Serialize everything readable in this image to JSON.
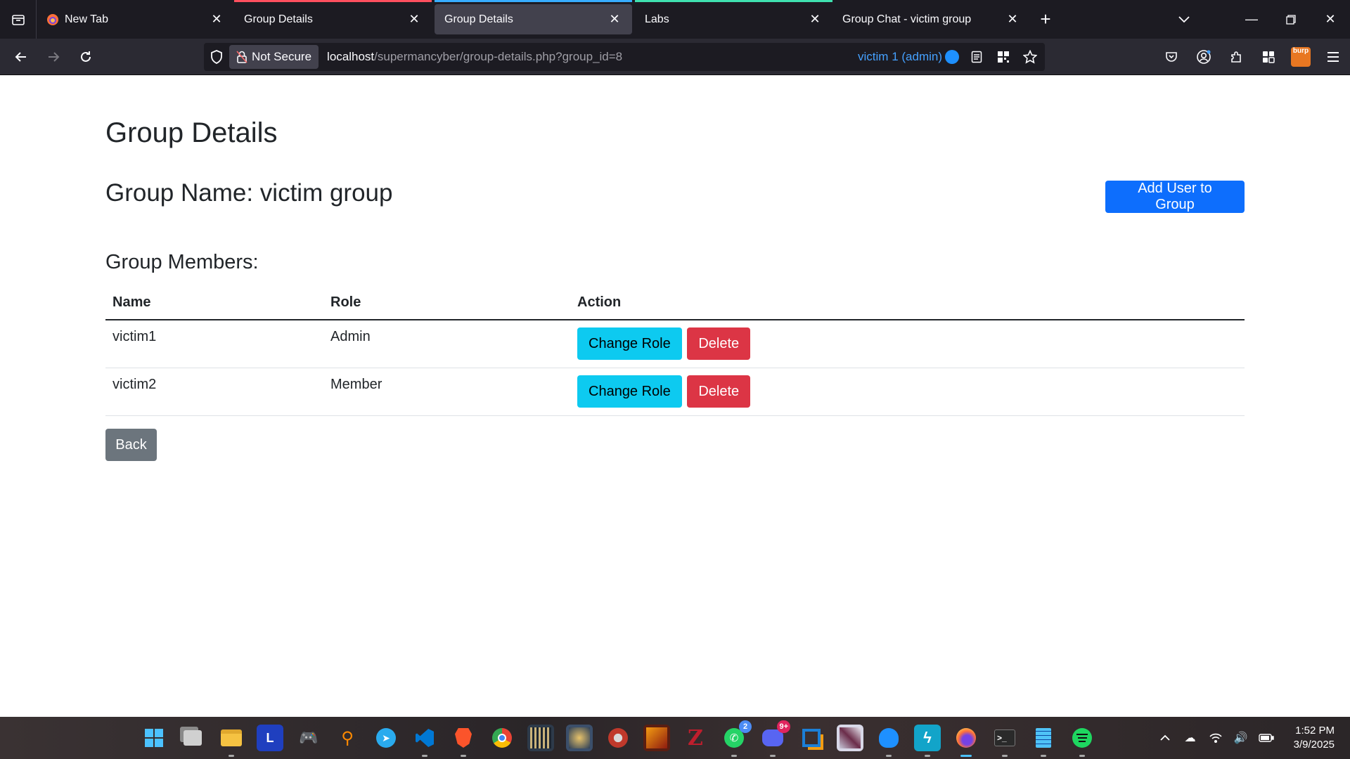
{
  "browser": {
    "tabs": [
      {
        "label": "New Tab",
        "state": "normal",
        "favicon": "firefox-icon",
        "strip_color": ""
      },
      {
        "label": "Group Details",
        "state": "normal",
        "favicon": "",
        "strip_color": "#ff4f5e"
      },
      {
        "label": "Group Details",
        "state": "active",
        "favicon": "",
        "strip_color": "#37adff"
      },
      {
        "label": "Labs",
        "state": "normal",
        "favicon": "",
        "strip_color": "#3fe1b0"
      },
      {
        "label": "Group Chat - victim group",
        "state": "normal",
        "favicon": "",
        "strip_color": ""
      }
    ],
    "security_label": "Not Secure",
    "url": {
      "host": "localhost",
      "path": "/supermancyber/group-details.php?group_id=8"
    },
    "container_label": "victim 1 (admin)",
    "container_color": "#45a1ff"
  },
  "page": {
    "title": "Group Details",
    "group_name": "Group Name: victim group",
    "add_user_label": "Add User to Group",
    "members_heading": "Group Members:",
    "table": {
      "headers": {
        "name": "Name",
        "role": "Role",
        "action": "Action"
      },
      "rows": [
        {
          "name": "victim1",
          "role": "Admin",
          "change_role": "Change Role",
          "delete": "Delete"
        },
        {
          "name": "victim2",
          "role": "Member",
          "change_role": "Change Role",
          "delete": "Delete"
        }
      ]
    },
    "back_label": "Back",
    "colors": {
      "primary": "#0d6efd",
      "info": "#0dcaf0",
      "danger": "#dc3545",
      "secondary": "#6c757d"
    }
  },
  "taskbar": {
    "apps": [
      "windows-start-icon",
      "task-view-icon",
      "file-explorer-icon",
      "l-app-icon",
      "game-controller-icon",
      "search-app-icon",
      "telegram-icon",
      "vscode-icon",
      "brave-icon",
      "chrome-icon",
      "game-app-1-icon",
      "game-app-2-icon",
      "red-app-icon",
      "game-app-3-icon",
      "filezilla-icon",
      "whatsapp-icon",
      "discord-icon",
      "virtualbox-icon",
      "game-app-4-icon",
      "blue-app-icon",
      "bolt-app-icon",
      "firefox-icon",
      "terminal-icon",
      "notepad-icon",
      "spotify-icon"
    ],
    "whatsapp_badge": "2",
    "discord_badge": "9+",
    "time": "1:52 PM",
    "date": "3/9/2025"
  }
}
